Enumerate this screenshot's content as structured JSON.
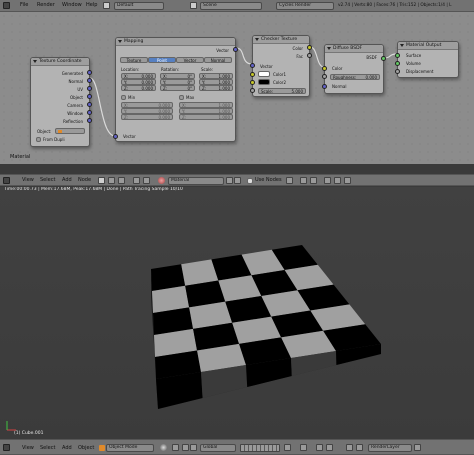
{
  "top_bar": {
    "menus": [
      "File",
      "Render",
      "Window",
      "Help"
    ],
    "layout": "Default",
    "scene": "Scene",
    "engine": "Cycles Render",
    "stats": "v2.74 | Verts:80 | Faces:76 | Tris:152 | Objects:1/4 | L"
  },
  "nodes": {
    "texcoord": {
      "title": "Texture Coordinate",
      "outputs": [
        "Generated",
        "Normal",
        "UV",
        "Object",
        "Camera",
        "Window",
        "Reflection"
      ],
      "object_label": "Object:",
      "from_dupli": "From Dupli",
      "vector_label": "Vector"
    },
    "mapping": {
      "title": "Mapping",
      "vector_out": "Vector",
      "tabs": [
        "Texture",
        "Point",
        "Vector",
        "Normal"
      ],
      "location_label": "Location:",
      "rotation_label": "Rotation:",
      "scale_label": "Scale:",
      "loc_fields": [
        "X:",
        "Y:",
        "Z:"
      ],
      "loc_values": [
        "0.000",
        "0.000",
        "0.000"
      ],
      "rot_values": [
        "0°",
        "0°",
        "0°"
      ],
      "scale_values": [
        "1.000",
        "1.000",
        "1.000"
      ],
      "min_label": "Min",
      "max_label": "Max",
      "min_values": [
        "0.000",
        "0.000",
        "0.000"
      ],
      "max_values": [
        "1.000",
        "1.000",
        "1.000"
      ],
      "vector_in": "Vector"
    },
    "checker": {
      "title": "Checker Texture",
      "outputs": [
        "Color",
        "Fac"
      ],
      "inputs": [
        "Vector",
        "Color1",
        "Color2"
      ],
      "scale_label": "Scale:",
      "scale_value": "5.000"
    },
    "diffuse": {
      "title": "Diffuse BSDF",
      "output": "BSDF",
      "color_label": "Color",
      "roughness_label": "Roughness:",
      "roughness_value": "0.000",
      "normal_label": "Normal"
    },
    "output": {
      "title": "Material Output",
      "inputs": [
        "Surface",
        "Volume",
        "Displacement"
      ]
    },
    "frame_label": "Material"
  },
  "node_header": {
    "menus": [
      "View",
      "Select",
      "Add",
      "Node"
    ],
    "material": "Material",
    "use_nodes": "Use Nodes"
  },
  "viewport": {
    "status": "Time:00:00.73 | Mem:17.68M, Peak:17.68M | Done | Path Tracing Sample 10/10",
    "object_name": "(1) Cube.001",
    "checker_colors": {
      "light": "#a0a0a0",
      "dark": "#000000",
      "side": "#2c2c2c"
    }
  },
  "bottom_bar": {
    "menus": [
      "View",
      "Select",
      "Add",
      "Object"
    ],
    "mode": "Object Mode",
    "orientation": "Global",
    "render_layer": "RenderLayer"
  }
}
